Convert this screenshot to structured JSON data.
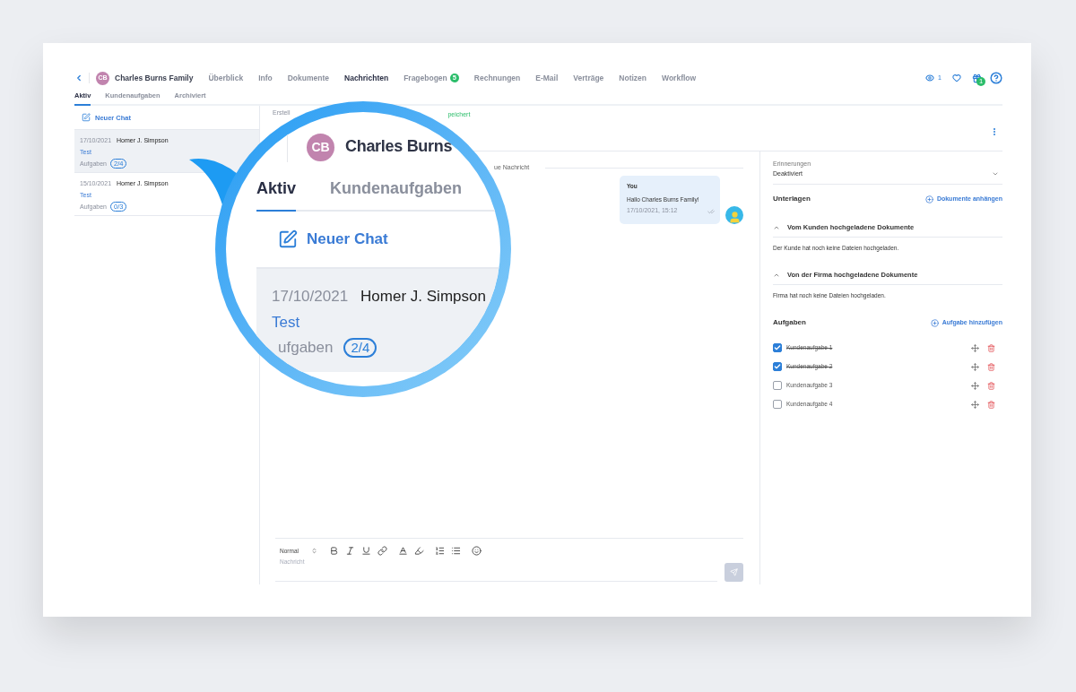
{
  "nav": {
    "client": {
      "initials": "CB",
      "name": "Charles Burns Family"
    },
    "tabs": [
      {
        "label": "Überblick",
        "selected": false
      },
      {
        "label": "Info",
        "selected": false
      },
      {
        "label": "Dokumente",
        "selected": false
      },
      {
        "label": "Nachrichten",
        "selected": true
      },
      {
        "label": "Fragebogen",
        "selected": false,
        "badge": "5"
      },
      {
        "label": "Rechnungen",
        "selected": false
      },
      {
        "label": "E-Mail",
        "selected": false
      },
      {
        "label": "Verträge",
        "selected": false
      },
      {
        "label": "Notizen",
        "selected": false
      },
      {
        "label": "Workflow",
        "selected": false
      }
    ],
    "views": "1",
    "gift_badge": "1"
  },
  "subtabs": [
    {
      "label": "Aktiv",
      "selected": true
    },
    {
      "label": "Kundenaufgaben",
      "selected": false
    },
    {
      "label": "Archiviert",
      "selected": false
    }
  ],
  "new_chat": "Neuer Chat",
  "chats": [
    {
      "date": "17/10/2021",
      "name": "Homer J. Simpson",
      "subject": "Test",
      "tasks_label": "Aufgaben",
      "tasks_count": "2/4",
      "selected": true
    },
    {
      "date": "15/10/2021",
      "name": "Homer J. Simpson",
      "subject": "Test",
      "tasks_label": "Aufgaben",
      "tasks_count": "0/3",
      "selected": false
    }
  ],
  "chat_header": {
    "created_label": "Erstell",
    "status": "peichert"
  },
  "divider_label": "ue Nachricht",
  "messages": [
    {
      "sender": "You",
      "text": "Hallo Charles Burns Family!",
      "time": "17/10/2021, 15:12"
    }
  ],
  "editor": {
    "format": "Normal",
    "placeholder": "Nachricht"
  },
  "side": {
    "reminders": {
      "label": "Erinnerungen",
      "value": "Deaktiviert"
    },
    "documents": {
      "title": "Unterlagen",
      "action": "Dokumente anhängen",
      "sections": [
        {
          "title": "Vom Kunden hochgeladene Dokumente",
          "expanded": true,
          "empty_text": "Der Kunde hat noch keine Dateien hochgeladen."
        },
        {
          "title": "Von der Firma hochgeladene Dokumente",
          "expanded": true,
          "empty_text": "Firma hat noch keine Dateien hochgeladen."
        }
      ]
    },
    "tasks": {
      "title": "Aufgaben",
      "action": "Aufgabe hinzufügen",
      "items": [
        {
          "label": "Kundenaufgabe 1",
          "checked": true
        },
        {
          "label": "Kundenaufgabe 2",
          "checked": true
        },
        {
          "label": "Kundenaufgabe 3",
          "checked": false
        },
        {
          "label": "Kundenaufgabe 4",
          "checked": false
        }
      ]
    }
  },
  "magnifier": {
    "initials": "CB",
    "title": "Charles Burns",
    "tabs": [
      {
        "label": "Aktiv",
        "selected": true
      },
      {
        "label": "Kundenaufgaben",
        "selected": false
      }
    ],
    "new_chat": "Neuer Chat",
    "chat": {
      "date": "17/10/2021",
      "name": "Homer J. Simpson",
      "subject": "Test",
      "tasks_label": "ufgaben",
      "tasks_count": "2/4",
      "selected": true
    }
  }
}
